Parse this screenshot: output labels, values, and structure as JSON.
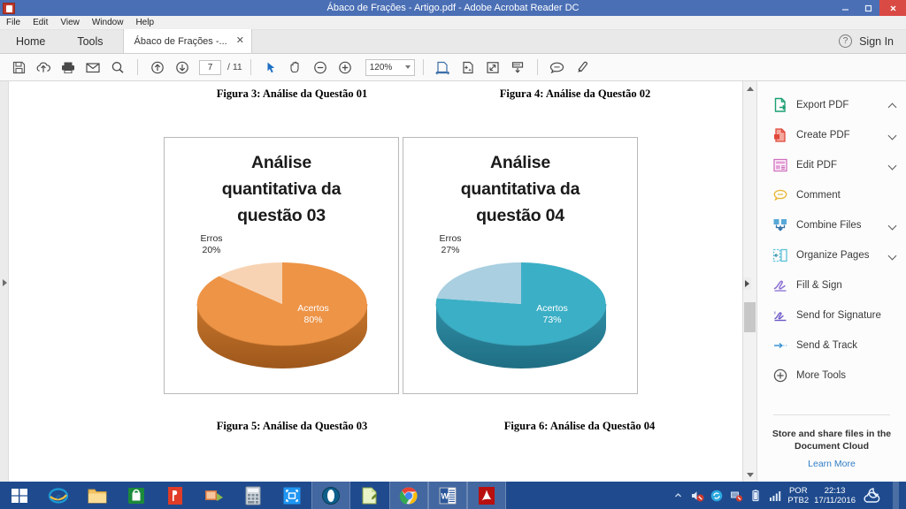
{
  "window": {
    "title": "Ábaco de Frações - Artigo.pdf - Adobe Acrobat Reader DC",
    "minimize": "–",
    "maximize": "❐",
    "close": "✕"
  },
  "menubar": {
    "items": [
      "File",
      "Edit",
      "View",
      "Window",
      "Help"
    ]
  },
  "tabbar": {
    "home": "Home",
    "tools": "Tools",
    "doc_tab": "Ábaco de Frações -...",
    "doc_tab_close": "✕",
    "help": "?",
    "sign_in": "Sign In"
  },
  "toolbar": {
    "icons": [
      "save-icon",
      "upload-cloud-icon",
      "print-icon",
      "email-icon",
      "search-icon"
    ],
    "page_current": "7",
    "page_total": "/ 11",
    "zoom_value": "120%",
    "right_icons": [
      "fit-width-icon",
      "enhance-scan-icon",
      "fit-page-icon",
      "scroll-mode-icon",
      "comment-icon",
      "highlight-icon"
    ]
  },
  "document": {
    "caption_top_left": "Figura 3: Análise da Questão 01",
    "caption_top_right": "Figura 4: Análise da Questão 02",
    "caption_bottom_left": "Figura 5: Análise da Questão 03",
    "caption_bottom_right": "Figura 6: Análise da Questão 04"
  },
  "chart_data": [
    {
      "type": "pie",
      "title": "Análise quantitativa da questão 03",
      "title_lines": [
        "Análise",
        "quantitativa da",
        "questão 03"
      ],
      "categories": [
        "Acertos",
        "Erros"
      ],
      "values": [
        80,
        20
      ],
      "labels": [
        "80%",
        "20%"
      ],
      "colors": [
        "#ED9447",
        "#F8D3B3"
      ],
      "side_colors": [
        "#B26322",
        "#D9A878"
      ],
      "legend": "none",
      "three_d": true
    },
    {
      "type": "pie",
      "title": "Análise quantitativa da questão 04",
      "title_lines": [
        "Análise",
        "quantitativa da",
        "questão 04"
      ],
      "categories": [
        "Acertos",
        "Erros"
      ],
      "values": [
        73,
        27
      ],
      "labels": [
        "73%",
        "27%"
      ],
      "colors": [
        "#3BAFC6",
        "#A9CFE0"
      ],
      "side_colors": [
        "#2A7E95",
        "#7FA9BC"
      ],
      "legend": "none",
      "three_d": true
    }
  ],
  "sidebar": {
    "items": [
      {
        "label": "Export PDF",
        "icon": "export-pdf-icon",
        "chevron": "up"
      },
      {
        "label": "Create PDF",
        "icon": "create-pdf-icon",
        "chevron": "down"
      },
      {
        "label": "Edit PDF",
        "icon": "edit-pdf-icon",
        "chevron": "down"
      },
      {
        "label": "Comment",
        "icon": "comment-icon",
        "chevron": "none"
      },
      {
        "label": "Combine Files",
        "icon": "combine-files-icon",
        "chevron": "down"
      },
      {
        "label": "Organize Pages",
        "icon": "organize-pages-icon",
        "chevron": "down"
      },
      {
        "label": "Fill & Sign",
        "icon": "fill-sign-icon",
        "chevron": "none"
      },
      {
        "label": "Send for Signature",
        "icon": "send-signature-icon",
        "chevron": "none"
      },
      {
        "label": "Send & Track",
        "icon": "send-track-icon",
        "chevron": "none"
      },
      {
        "label": "More Tools",
        "icon": "more-tools-icon",
        "chevron": "none"
      }
    ],
    "footer_line1": "Store and share files in the",
    "footer_line2": "Document Cloud",
    "learn_more": "Learn More"
  },
  "taskbar": {
    "start": "start-button",
    "apps": [
      "internet-explorer-icon",
      "file-explorer-icon",
      "store-icon",
      "pdf-reader-icon",
      "media-icon",
      "calculator-icon",
      "capture-icon",
      "opera-icon",
      "notepad-icon",
      "chrome-icon",
      "word-icon",
      "acrobat-icon"
    ],
    "tray": {
      "overflow": "▲",
      "volume": "muted-speaker-icon",
      "sync": "sync-icon",
      "network": "network-error-icon",
      "battery": "battery-icon",
      "signal": "signal-bars-icon",
      "lang_line1": "POR",
      "lang_line2": "PTB2",
      "time": "22:13",
      "date": "17/11/2016",
      "weather": "weather-cloud-moon-icon"
    }
  }
}
